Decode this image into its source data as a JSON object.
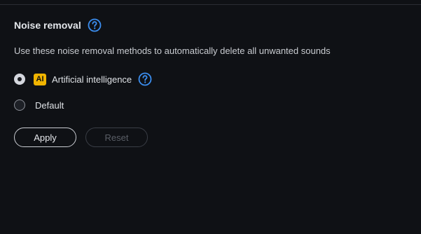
{
  "section": {
    "title": "Noise removal",
    "description": "Use these noise removal methods to automatically delete all unwanted sounds"
  },
  "options": [
    {
      "badge": "AI",
      "label": "Artificial intelligence",
      "selected": true
    },
    {
      "label": "Default",
      "selected": false
    }
  ],
  "buttons": {
    "apply_label": "Apply",
    "reset_label": "Reset",
    "reset_enabled": false
  },
  "colors": {
    "background": "#0f1115",
    "accent_blue": "#3b8ef0",
    "ai_badge": "#f0b400"
  },
  "icons": {
    "help": "question-circle-icon"
  }
}
